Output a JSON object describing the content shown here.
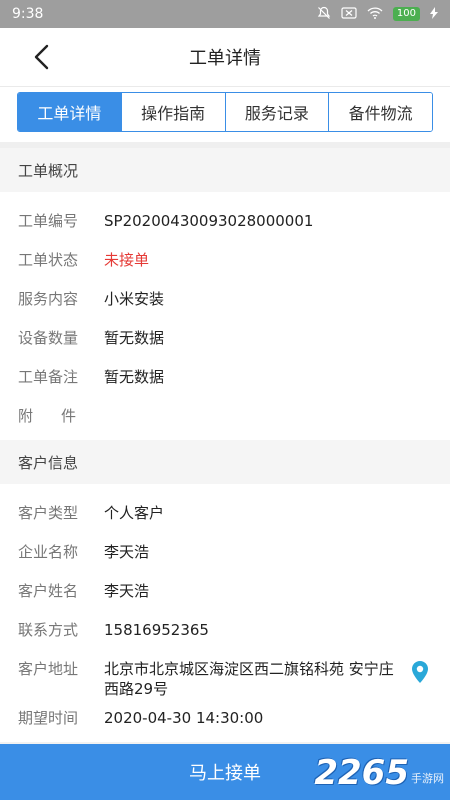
{
  "status_bar": {
    "time": "9:38",
    "battery": "100"
  },
  "nav": {
    "title": "工单详情"
  },
  "tabs": [
    {
      "label": "工单详情",
      "active": true
    },
    {
      "label": "操作指南",
      "active": false
    },
    {
      "label": "服务记录",
      "active": false
    },
    {
      "label": "备件物流",
      "active": false
    }
  ],
  "order_overview": {
    "title": "工单概况",
    "rows": [
      {
        "label": "工单编号",
        "value": "SP20200430093028000001"
      },
      {
        "label": "工单状态",
        "value": "未接单"
      },
      {
        "label": "服务内容",
        "value": "小米安装"
      },
      {
        "label": "设备数量",
        "value": "暂无数据"
      },
      {
        "label": "工单备注",
        "value": "暂无数据"
      },
      {
        "label": "附件",
        "value": ""
      }
    ]
  },
  "customer_info": {
    "title": "客户信息",
    "rows": [
      {
        "label": "客户类型",
        "value": "个人客户"
      },
      {
        "label": "企业名称",
        "value": "李天浩"
      },
      {
        "label": "客户姓名",
        "value": "李天浩"
      },
      {
        "label": "联系方式",
        "value": "15816952365"
      },
      {
        "label": "客户地址",
        "value": "北京市北京城区海淀区西二旗铭科苑 安宁庄西路29号"
      },
      {
        "label": "期望时间",
        "value": "2020-04-30 14:30:00"
      }
    ]
  },
  "bottom_button": {
    "label": "马上接单"
  },
  "watermark": {
    "number": "2265",
    "text": "手游网"
  },
  "colors": {
    "accent": "#3a8ee6",
    "status_red": "#e53935"
  }
}
